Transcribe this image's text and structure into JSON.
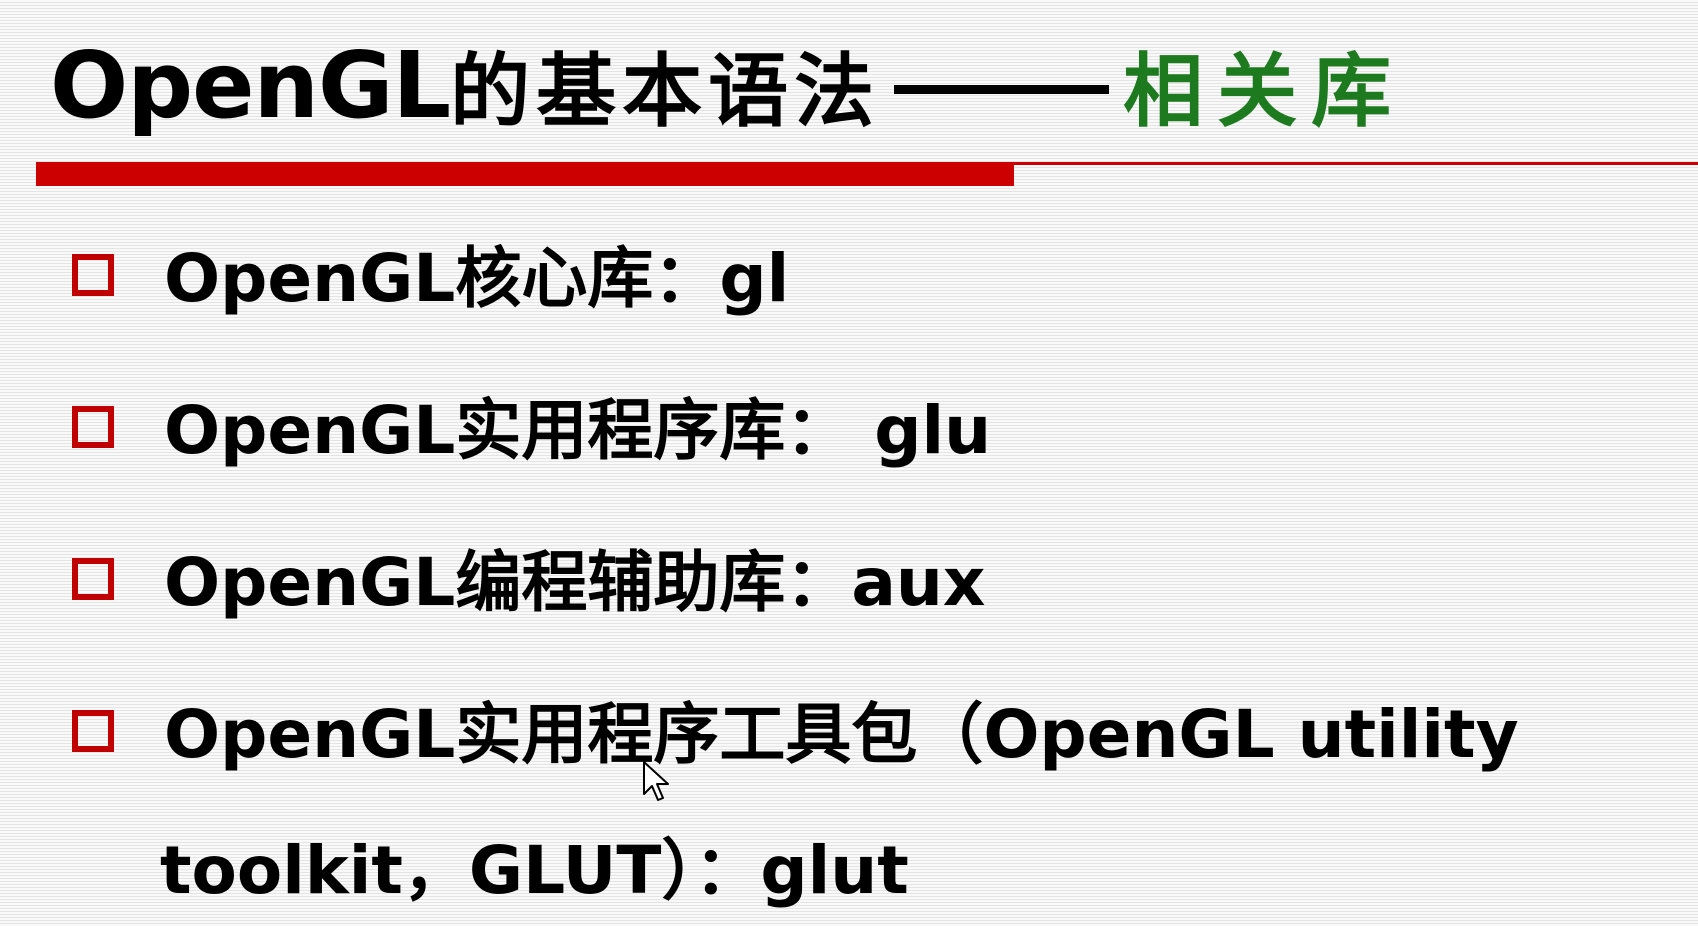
{
  "slide": {
    "title": {
      "prefix": "OpenGL",
      "main": "的基本语法",
      "accent": "相关库",
      "accent_color": "#1e7a1e"
    },
    "rule_color": "#cc0000",
    "bullet_icon": "hollow-square",
    "items": [
      {
        "text": "OpenGL核心库：gl"
      },
      {
        "text": "OpenGL实用程序库： glu"
      },
      {
        "text": "OpenGL编程辅助库：aux"
      },
      {
        "text": "OpenGL实用程序工具包（OpenGL utility"
      }
    ],
    "continuation": "toolkit，GLUT）：glut",
    "cursor_icon": "mouse-pointer"
  }
}
